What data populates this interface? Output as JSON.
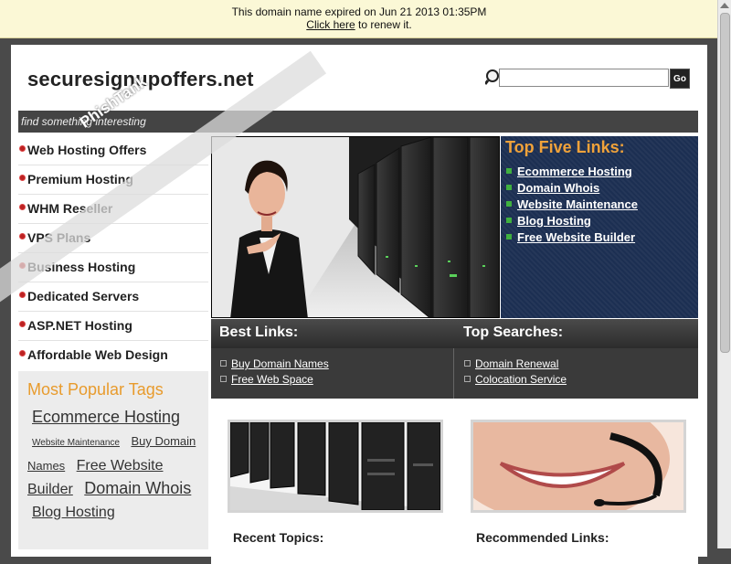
{
  "notice": {
    "line1": "This domain name expired on Jun 21 2013 01:35PM",
    "link": "Click here",
    "rest": " to renew it."
  },
  "header": {
    "logo": "securesignupoffers.net",
    "search_placeholder": "",
    "go_label": "Go",
    "tagline": "find something interesting"
  },
  "sidebar": {
    "items": [
      {
        "label": "Web Hosting Offers"
      },
      {
        "label": "Premium Hosting"
      },
      {
        "label": "WHM Reseller"
      },
      {
        "label": "VPS Plans"
      },
      {
        "label": "Business Hosting"
      },
      {
        "label": "Dedicated Servers"
      },
      {
        "label": "ASP.NET Hosting"
      },
      {
        "label": "Affordable Web Design"
      }
    ],
    "tags_title": "Most Popular Tags",
    "tags": [
      "Ecommerce Hosting",
      "Website Maintenance",
      "Buy Domain Names",
      "Free Website Builder",
      "Domain Whois",
      "Blog Hosting"
    ]
  },
  "top_five": {
    "title": "Top Five Links:",
    "links": [
      "Ecommerce Hosting",
      "Domain Whois",
      "Website Maintenance",
      "Blog Hosting",
      "Free Website Builder"
    ]
  },
  "best_links": {
    "title": "Best Links:",
    "links": [
      "Buy Domain Names",
      "Free Web Space"
    ]
  },
  "top_searches": {
    "title": "Top Searches:",
    "links": [
      "Domain Renewal",
      "Colocation Service"
    ]
  },
  "lower": {
    "recent_title": "Recent Topics:",
    "recommended_title": "Recommended Links:"
  },
  "watermark": "PhishTank",
  "colors": {
    "notice_bg": "#fbf8d6",
    "accent_orange": "#e89b2d",
    "top_five_bg": "#1c2f52",
    "bullet_green": "#3fb03f",
    "bullet_red": "#b22222"
  }
}
